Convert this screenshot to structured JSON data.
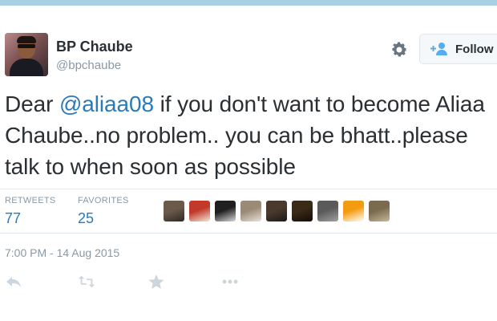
{
  "tweet": {
    "author_name": "BP Chaube",
    "author_handle": "@bpchaube",
    "follow_label": "Follow",
    "text_before": "Dear ",
    "mention": "@aliaa08",
    "text_after": " if you don't want to become Aliaa Chaube..no problem.. you can be bhatt..please talk to when soon as possible",
    "timestamp": "7:00 PM - 14 Aug 2015"
  },
  "stats": {
    "retweets_label": "RETWEETS",
    "retweets_value": "77",
    "favorites_label": "FAVORITES",
    "favorites_value": "25"
  },
  "favorited_by": [
    {
      "colors": [
        "#6b5a4a",
        "#2e2a26"
      ]
    },
    {
      "colors": [
        "#c0392b",
        "#f3e6d8"
      ]
    },
    {
      "colors": [
        "#1f1f1f",
        "#d8d8d8"
      ]
    },
    {
      "colors": [
        "#9a8a78",
        "#e8e2d8"
      ]
    },
    {
      "colors": [
        "#4a3a2e",
        "#1a1a1a"
      ]
    },
    {
      "colors": [
        "#3a2a18",
        "#120c08"
      ]
    },
    {
      "colors": [
        "#5a5a5a",
        "#a0a0a0"
      ]
    },
    {
      "colors": [
        "#f39c12",
        "#ffffff"
      ]
    },
    {
      "colors": [
        "#7a6a50",
        "#c8b898"
      ]
    }
  ],
  "icons": {
    "settings": "gear-icon",
    "follow": "add-user-icon",
    "reply": "reply-icon",
    "retweet": "retweet-icon",
    "favorite": "star-icon",
    "more": "more-icon"
  },
  "colors": {
    "link": "#2b7bb9",
    "muted": "#8899a6",
    "text": "#292f33",
    "icon": "#ccd6dd",
    "top_bar": "#a9cfe3"
  }
}
